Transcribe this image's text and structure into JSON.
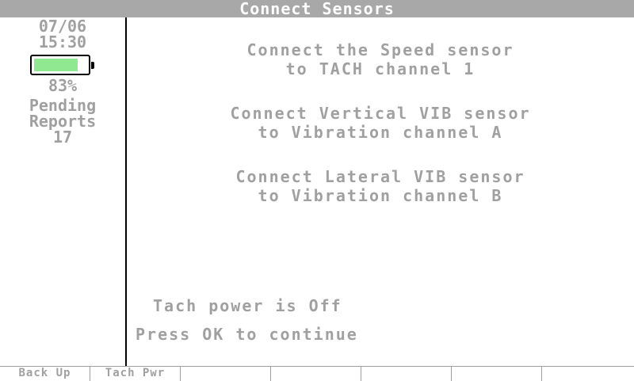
{
  "title": "Connect Sensors",
  "sidebar": {
    "date": "07/06",
    "time": "15:30",
    "battery_percent_value": 0.83,
    "battery_label": "83%",
    "pending_label_1": "Pending",
    "pending_label_2": "Reports",
    "pending_count": "17"
  },
  "instructions": [
    {
      "line1": "Connect the Speed sensor",
      "line2": "to TACH channel 1"
    },
    {
      "line1": "Connect Vertical VIB sensor",
      "line2": "to Vibration channel A"
    },
    {
      "line1": "Connect Lateral VIB sensor",
      "line2": "to Vibration channel B"
    }
  ],
  "status": {
    "tach_power": "Tach power is Off",
    "prompt": "Press OK to continue"
  },
  "softkeys": [
    "Back Up",
    "Tach Pwr",
    "",
    "",
    "",
    "",
    ""
  ],
  "colors": {
    "title_bar": "#a8a8a8",
    "text": "#a0a0a0",
    "battery_fill": "#90e890"
  }
}
